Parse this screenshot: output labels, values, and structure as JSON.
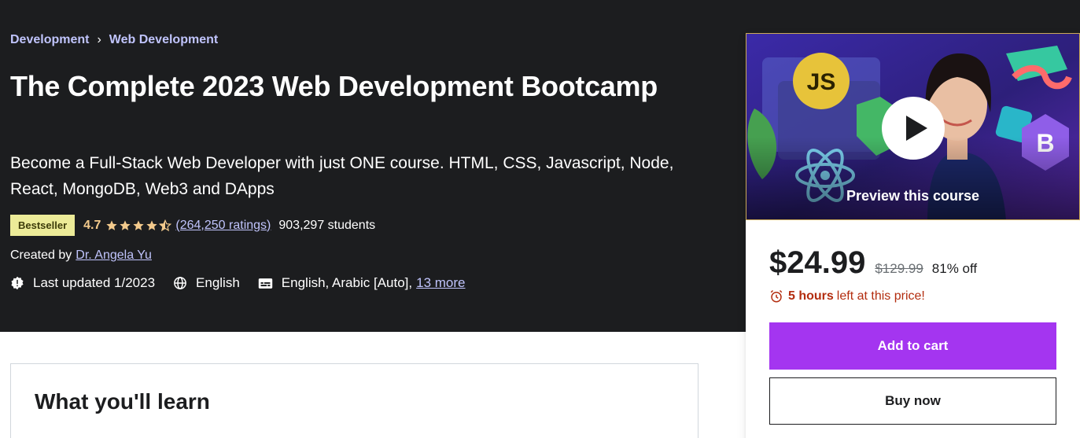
{
  "breadcrumb": {
    "items": [
      "Development",
      "Web Development"
    ],
    "separator": "›"
  },
  "course": {
    "title": "The Complete 2023 Web Development Bootcamp",
    "subtitle": "Become a Full-Stack Web Developer with just ONE course. HTML, CSS, Javascript, Node, React, MongoDB, Web3 and DApps",
    "badge": "Bestseller",
    "rating": "4.7",
    "rating_value": 4.7,
    "ratings_count": "(264,250 ratings)",
    "students": "903,297 students",
    "created_by_label": "Created by",
    "instructor": "Dr. Angela Yu",
    "last_updated": "Last updated 1/2023",
    "language": "English",
    "captions": "English, Arabic [Auto],",
    "captions_more": "13 more"
  },
  "learn": {
    "title": "What you'll learn"
  },
  "sidebar": {
    "preview_label": "Preview this course",
    "price": "$24.99",
    "original_price": "$129.99",
    "discount": "81% off",
    "timer_bold": "5 hours",
    "timer_rest": "left at this price!",
    "add_to_cart": "Add to cart",
    "buy_now": "Buy now"
  },
  "colors": {
    "hero_bg": "#1c1d1f",
    "accent_purple": "#a435f0",
    "link_purple": "#c0c4fc",
    "star_gold": "#f3ca8c",
    "badge_bg": "#eceb98",
    "timer_red": "#b32d0f"
  },
  "icons": {
    "stars": "star-icon",
    "last_updated": "alert-badge-icon",
    "language": "globe-icon",
    "captions": "closed-captions-icon",
    "timer": "alarm-clock-icon",
    "play": "play-icon"
  }
}
